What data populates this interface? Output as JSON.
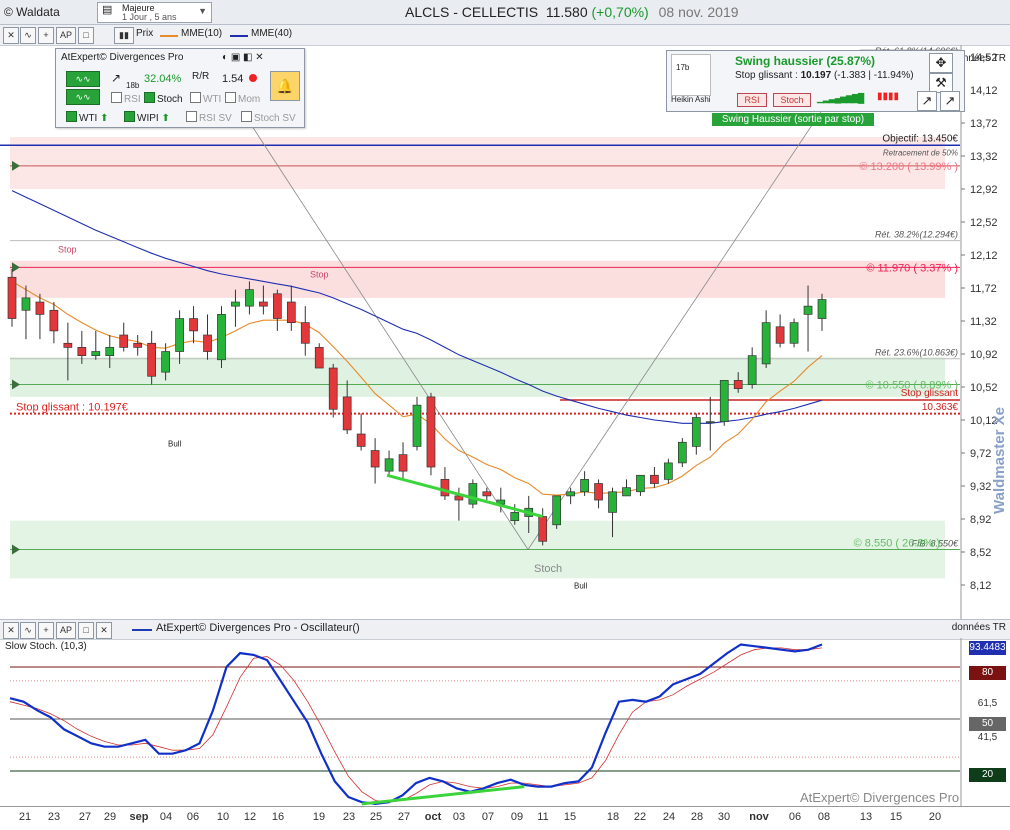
{
  "header": {
    "app": "© Waldata",
    "period_main": "Majeure",
    "period_sub": "1 Jour , 5 ans",
    "symbol": "ALCLS - CELLECTIS",
    "price": "11.580",
    "change": "(+0,70%)",
    "date": "08 nov. 2019",
    "donnees": "données TR"
  },
  "toolbar": {
    "prix": "Prix",
    "mme10": "MME(10)",
    "mme40": "MME(40)"
  },
  "divergences_panel": {
    "title": "AtExpert© Divergences Pro",
    "pct": "32.04%",
    "bars": "18b",
    "value": "1.54",
    "rsi": "RSI",
    "stoch": "Stoch",
    "wti_off": "WTI",
    "mom": "Mom",
    "wti": "WTI",
    "wipi": "WIPI",
    "rsi_sv": "RSI SV",
    "stoch_sv": "Stoch SV",
    "bars_17": "17b"
  },
  "swing_panel": {
    "title": "Swing haussier (25.87%)",
    "stop_label": "Stop glissant :",
    "stop_value": "10.197",
    "stop_change": "(-1.383 | -11.94%)",
    "rsi": "RSI",
    "stoch": "Stoch",
    "heikin": "Heikin Ashi",
    "banner": "Swing Haussier (sortie par stop)"
  },
  "levels": {
    "ret618": "Rét. 61.8%(14.606€)",
    "objectif": "Objectif: 13.450€",
    "retr50": "Retracement de 50%",
    "r13200": "© 13.200 ( 13.99% )",
    "ret382": "Rét. 38.2%(12.294€)",
    "r11970": "© 11.970 ( 3.37% )",
    "ret236": "Rét. 23.6%(10.863€)",
    "s10550": "© 10.550 ( 8.89% )",
    "stop_glissant": "Stop glissant",
    "stop_val": "10.363€",
    "stop_left": "Stop glissant : 10.197€",
    "s8550": "© 8.550 ( 26.8% )",
    "fib": "FIB: 8.550€",
    "stop_tag": "Stop",
    "bull": "Bull",
    "stoch_tag": "Stoch"
  },
  "watermark": "Waldmaster Xe",
  "oscillator": {
    "title": "AtExpert© Divergences Pro - Oscillateur()",
    "sub": "Slow Stoch. (10,3)",
    "brand": "AtExpert© Divergences Pro",
    "donnees": "données TR",
    "current": "93.4483",
    "l80": "80",
    "l615": "61,5",
    "l50": "50",
    "l415": "41,5",
    "l20": "20"
  },
  "colors": {
    "up": "#27b33a",
    "down": "#e2383c",
    "mme10": "#e88a2a",
    "mme40": "#1f2fb0",
    "stoch": "#1030c8",
    "signal": "#d23030"
  },
  "chart_data": [
    {
      "type": "candlestick",
      "ylim": [
        8.0,
        14.7
      ],
      "yticks": [
        "14,52",
        "14,12",
        "13,72",
        "13,32",
        "12,92",
        "12,52",
        "12,12",
        "11,72",
        "11,32",
        "10,92",
        "10,52",
        "10,12",
        "9,72",
        "9,32",
        "8,92",
        "8,52",
        "8,12"
      ],
      "x": [
        "21",
        "23",
        "27",
        "29",
        "sep",
        "04",
        "06",
        "10",
        "12",
        "16",
        "19",
        "23",
        "25",
        "27",
        "oct",
        "03",
        "07",
        "09",
        "11",
        "15",
        "18",
        "22",
        "24",
        "28",
        "30",
        "nov",
        "06",
        "08",
        "13",
        "15",
        "20"
      ],
      "candles": [
        {
          "o": 11.85,
          "h": 11.95,
          "l": 11.25,
          "c": 11.35
        },
        {
          "o": 11.45,
          "h": 11.75,
          "l": 11.1,
          "c": 11.6
        },
        {
          "o": 11.55,
          "h": 11.65,
          "l": 11.1,
          "c": 11.4
        },
        {
          "o": 11.45,
          "h": 11.55,
          "l": 11.05,
          "c": 11.2
        },
        {
          "o": 11.05,
          "h": 11.3,
          "l": 10.6,
          "c": 11.0
        },
        {
          "o": 11.0,
          "h": 11.2,
          "l": 10.8,
          "c": 10.9
        },
        {
          "o": 10.9,
          "h": 11.2,
          "l": 10.85,
          "c": 10.95
        },
        {
          "o": 10.9,
          "h": 11.15,
          "l": 10.75,
          "c": 11.0
        },
        {
          "o": 11.15,
          "h": 11.3,
          "l": 10.95,
          "c": 11.0
        },
        {
          "o": 11.05,
          "h": 11.15,
          "l": 10.9,
          "c": 11.0
        },
        {
          "o": 11.05,
          "h": 11.2,
          "l": 10.55,
          "c": 10.65
        },
        {
          "o": 10.7,
          "h": 11.05,
          "l": 10.6,
          "c": 10.95
        },
        {
          "o": 10.95,
          "h": 11.45,
          "l": 10.8,
          "c": 11.35
        },
        {
          "o": 11.35,
          "h": 11.5,
          "l": 11.05,
          "c": 11.2
        },
        {
          "o": 11.15,
          "h": 11.4,
          "l": 10.85,
          "c": 10.95
        },
        {
          "o": 10.85,
          "h": 11.5,
          "l": 10.75,
          "c": 11.4
        },
        {
          "o": 11.5,
          "h": 11.7,
          "l": 11.25,
          "c": 11.55
        },
        {
          "o": 11.5,
          "h": 11.8,
          "l": 11.4,
          "c": 11.7
        },
        {
          "o": 11.55,
          "h": 11.75,
          "l": 11.4,
          "c": 11.5
        },
        {
          "o": 11.65,
          "h": 11.7,
          "l": 11.2,
          "c": 11.35
        },
        {
          "o": 11.55,
          "h": 11.75,
          "l": 11.2,
          "c": 11.3
        },
        {
          "o": 11.3,
          "h": 11.5,
          "l": 10.9,
          "c": 11.05
        },
        {
          "o": 11.0,
          "h": 11.05,
          "l": 10.75,
          "c": 10.75
        },
        {
          "o": 10.75,
          "h": 10.8,
          "l": 10.15,
          "c": 10.25
        },
        {
          "o": 10.4,
          "h": 10.6,
          "l": 9.95,
          "c": 10.0
        },
        {
          "o": 9.95,
          "h": 10.2,
          "l": 9.75,
          "c": 9.8
        },
        {
          "o": 9.75,
          "h": 9.9,
          "l": 9.35,
          "c": 9.55
        },
        {
          "o": 9.5,
          "h": 9.75,
          "l": 9.45,
          "c": 9.65
        },
        {
          "o": 9.7,
          "h": 9.85,
          "l": 9.4,
          "c": 9.5
        },
        {
          "o": 9.8,
          "h": 10.4,
          "l": 9.75,
          "c": 10.3
        },
        {
          "o": 10.4,
          "h": 10.45,
          "l": 9.45,
          "c": 9.55
        },
        {
          "o": 9.4,
          "h": 9.55,
          "l": 9.15,
          "c": 9.2
        },
        {
          "o": 9.2,
          "h": 9.3,
          "l": 8.9,
          "c": 9.15
        },
        {
          "o": 9.1,
          "h": 9.4,
          "l": 9.05,
          "c": 9.35
        },
        {
          "o": 9.25,
          "h": 9.3,
          "l": 9.15,
          "c": 9.2
        },
        {
          "o": 9.1,
          "h": 9.3,
          "l": 9.0,
          "c": 9.15
        },
        {
          "o": 8.9,
          "h": 9.1,
          "l": 8.85,
          "c": 9.0
        },
        {
          "o": 8.95,
          "h": 9.2,
          "l": 8.75,
          "c": 9.05
        },
        {
          "o": 8.95,
          "h": 9.05,
          "l": 8.6,
          "c": 8.65
        },
        {
          "o": 8.85,
          "h": 9.2,
          "l": 8.8,
          "c": 9.2
        },
        {
          "o": 9.2,
          "h": 9.3,
          "l": 9.1,
          "c": 9.25
        },
        {
          "o": 9.25,
          "h": 9.5,
          "l": 9.2,
          "c": 9.4
        },
        {
          "o": 9.35,
          "h": 9.4,
          "l": 9.05,
          "c": 9.15
        },
        {
          "o": 9.0,
          "h": 9.3,
          "l": 8.7,
          "c": 9.25
        },
        {
          "o": 9.2,
          "h": 9.4,
          "l": 9.2,
          "c": 9.3
        },
        {
          "o": 9.25,
          "h": 9.45,
          "l": 9.2,
          "c": 9.45
        },
        {
          "o": 9.45,
          "h": 9.55,
          "l": 9.3,
          "c": 9.35
        },
        {
          "o": 9.4,
          "h": 9.65,
          "l": 9.35,
          "c": 9.6
        },
        {
          "o": 9.6,
          "h": 9.9,
          "l": 9.55,
          "c": 9.85
        },
        {
          "o": 9.8,
          "h": 10.2,
          "l": 9.7,
          "c": 10.15
        },
        {
          "o": 10.1,
          "h": 10.4,
          "l": 9.75,
          "c": 10.1
        },
        {
          "o": 10.1,
          "h": 10.6,
          "l": 10.05,
          "c": 10.6
        },
        {
          "o": 10.6,
          "h": 10.7,
          "l": 10.45,
          "c": 10.5
        },
        {
          "o": 10.55,
          "h": 11.0,
          "l": 10.5,
          "c": 10.9
        },
        {
          "o": 10.8,
          "h": 11.45,
          "l": 10.75,
          "c": 11.3
        },
        {
          "o": 11.25,
          "h": 11.4,
          "l": 11.0,
          "c": 11.05
        },
        {
          "o": 11.05,
          "h": 11.35,
          "l": 11.0,
          "c": 11.3
        },
        {
          "o": 11.4,
          "h": 11.75,
          "l": 10.95,
          "c": 11.5
        },
        {
          "o": 11.35,
          "h": 11.65,
          "l": 11.2,
          "c": 11.58
        }
      ],
      "mme10": [
        11.8,
        11.7,
        11.6,
        11.52,
        11.4,
        11.3,
        11.21,
        11.14,
        11.1,
        11.07,
        11.0,
        10.99,
        11.05,
        11.08,
        11.06,
        11.12,
        11.2,
        11.29,
        11.33,
        11.33,
        11.33,
        11.28,
        11.18,
        11.01,
        10.83,
        10.64,
        10.44,
        10.3,
        10.16,
        10.19,
        10.07,
        9.89,
        9.75,
        9.67,
        9.58,
        9.52,
        9.42,
        9.35,
        9.22,
        9.21,
        9.22,
        9.25,
        9.23,
        9.24,
        9.25,
        9.29,
        9.3,
        9.35,
        9.44,
        9.57,
        9.67,
        9.84,
        9.95,
        10.13,
        10.34,
        10.47,
        10.59,
        10.76,
        10.9
      ],
      "mme40": [
        12.9,
        12.82,
        12.74,
        12.66,
        12.58,
        12.5,
        12.42,
        12.35,
        12.28,
        12.21,
        12.14,
        12.08,
        12.03,
        11.98,
        11.93,
        11.89,
        11.86,
        11.83,
        11.8,
        11.77,
        11.74,
        11.7,
        11.66,
        11.6,
        11.53,
        11.46,
        11.38,
        11.3,
        11.22,
        11.17,
        11.09,
        11.0,
        10.91,
        10.84,
        10.77,
        10.7,
        10.62,
        10.55,
        10.47,
        10.41,
        10.36,
        10.31,
        10.26,
        10.22,
        10.18,
        10.15,
        10.12,
        10.1,
        10.08,
        10.08,
        10.08,
        10.1,
        10.12,
        10.15,
        10.19,
        10.22,
        10.26,
        10.31,
        10.36
      ],
      "levels": [
        13.45,
        13.2,
        12.294,
        11.97,
        10.863,
        10.55,
        10.363,
        10.197,
        8.55
      ]
    },
    {
      "type": "line",
      "ylim": [
        0,
        100
      ],
      "title": "Slow Stoch. (10,3)",
      "stoch": [
        62,
        60,
        55,
        51,
        44,
        40,
        36,
        34,
        34,
        36,
        38,
        30,
        30,
        32,
        36,
        55,
        80,
        88,
        87,
        84,
        72,
        60,
        48,
        30,
        14,
        5,
        2,
        1,
        2,
        6,
        13,
        16,
        14,
        10,
        8,
        10,
        13,
        15,
        12,
        11,
        11,
        13,
        14,
        22,
        42,
        60,
        61,
        60,
        63,
        70,
        73,
        76,
        82,
        88,
        93,
        92,
        91,
        90,
        89,
        90,
        93
      ],
      "signal": [
        60,
        58,
        56,
        53,
        49,
        44,
        40,
        37,
        35,
        35,
        36,
        34,
        32,
        32,
        33,
        41,
        57,
        74,
        85,
        86,
        81,
        72,
        60,
        46,
        31,
        17,
        8,
        3,
        2,
        3,
        7,
        12,
        14,
        13,
        11,
        10,
        11,
        13,
        13,
        12,
        11,
        12,
        13,
        16,
        26,
        41,
        54,
        60,
        61,
        64,
        69,
        73,
        77,
        82,
        87,
        90,
        91,
        91,
        90,
        90,
        91
      ]
    }
  ],
  "x_ticks": [
    {
      "label": "21",
      "bold": false
    },
    {
      "label": "23",
      "bold": false
    },
    {
      "label": "27",
      "bold": false
    },
    {
      "label": "29",
      "bold": false
    },
    {
      "label": "sep",
      "bold": true
    },
    {
      "label": "04",
      "bold": false
    },
    {
      "label": "06",
      "bold": false
    },
    {
      "label": "10",
      "bold": false
    },
    {
      "label": "12",
      "bold": false
    },
    {
      "label": "16",
      "bold": false
    },
    {
      "label": "19",
      "bold": false
    },
    {
      "label": "23",
      "bold": false
    },
    {
      "label": "25",
      "bold": false
    },
    {
      "label": "27",
      "bold": false
    },
    {
      "label": "oct",
      "bold": true
    },
    {
      "label": "03",
      "bold": false
    },
    {
      "label": "07",
      "bold": false
    },
    {
      "label": "09",
      "bold": false
    },
    {
      "label": "11",
      "bold": false
    },
    {
      "label": "15",
      "bold": false
    },
    {
      "label": "18",
      "bold": false
    },
    {
      "label": "22",
      "bold": false
    },
    {
      "label": "24",
      "bold": false
    },
    {
      "label": "28",
      "bold": false
    },
    {
      "label": "30",
      "bold": false
    },
    {
      "label": "nov",
      "bold": true
    },
    {
      "label": "06",
      "bold": false
    },
    {
      "label": "08",
      "bold": false
    },
    {
      "label": "13",
      "bold": false
    },
    {
      "label": "15",
      "bold": false
    },
    {
      "label": "20",
      "bold": false
    }
  ]
}
